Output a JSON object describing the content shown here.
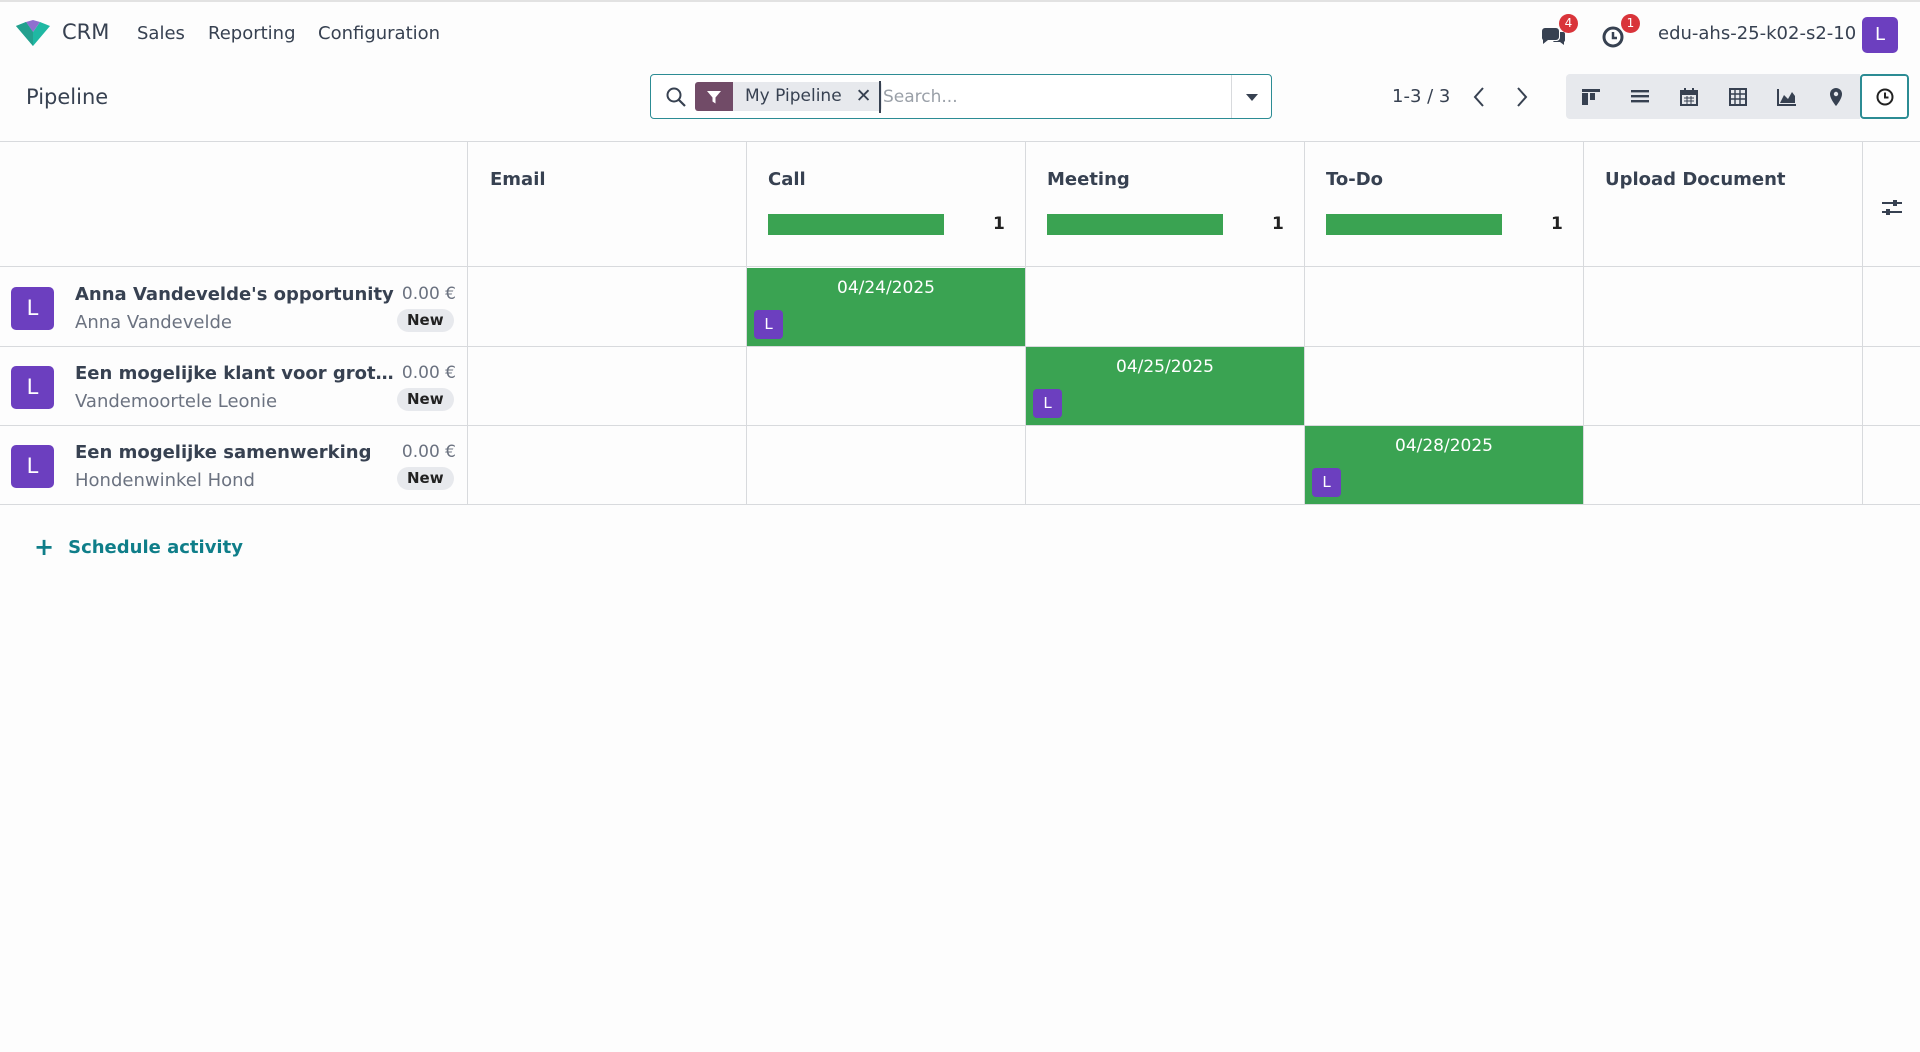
{
  "navbar": {
    "app_name": "CRM",
    "menu": [
      "Sales",
      "Reporting",
      "Configuration"
    ],
    "messages_badge": "4",
    "activities_badge": "1",
    "database": "edu-ahs-25-k02-s2-10",
    "user_initial": "L"
  },
  "control_panel": {
    "title": "Pipeline",
    "facet_label": "My Pipeline",
    "search_placeholder": "Search...",
    "pager": "1-3 / 3"
  },
  "columns": [
    {
      "title": "Email",
      "count": ""
    },
    {
      "title": "Call",
      "count": "1"
    },
    {
      "title": "Meeting",
      "count": "1"
    },
    {
      "title": "To-Do",
      "count": "1"
    },
    {
      "title": "Upload Document",
      "count": ""
    }
  ],
  "records": [
    {
      "name": "Anna Vandevelde's opportunity",
      "partner": "Anna Vandevelde",
      "amount": "0.00 €",
      "stage": "New",
      "avatar": "L",
      "activity_date": "04/24/2025",
      "activity_user": "L"
    },
    {
      "name": "Een mogelijke klant voor grote best...",
      "partner": "Vandemoortele Leonie",
      "amount": "0.00 €",
      "stage": "New",
      "avatar": "L",
      "activity_date": "04/25/2025",
      "activity_user": "L"
    },
    {
      "name": "Een mogelijke samenwerking",
      "partner": "Hondenwinkel Hond",
      "amount": "0.00 €",
      "stage": "New",
      "avatar": "L",
      "activity_date": "04/28/2025",
      "activity_user": "L"
    }
  ],
  "schedule_label": "Schedule activity",
  "colors": {
    "accent": "#2c8c94",
    "brand": "#714b67",
    "activity": "#3aa352",
    "avatar": "#6c3fbf"
  }
}
